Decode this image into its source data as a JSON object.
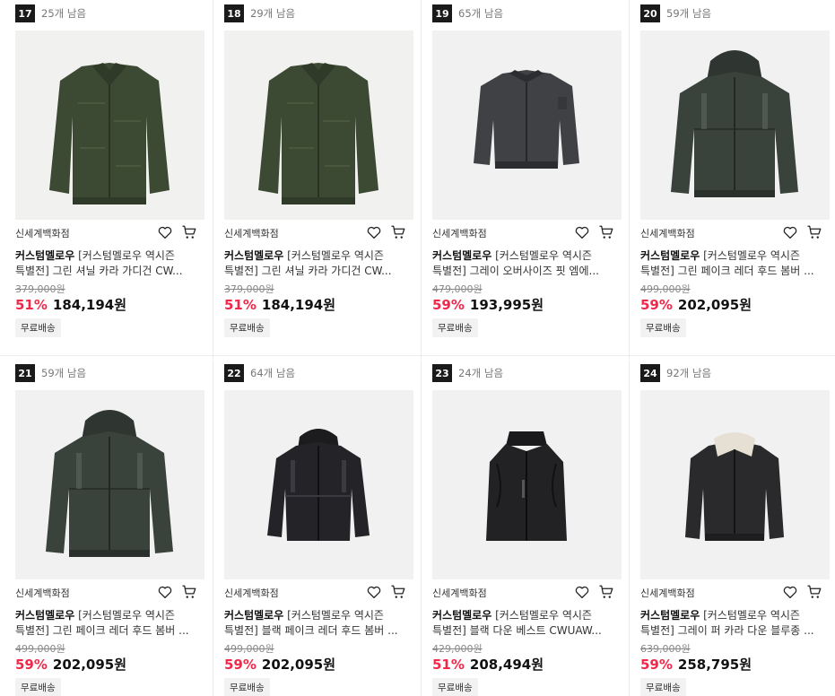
{
  "products": [
    {
      "rank": "17",
      "remaining": "25개 남음",
      "image": "green-knit-cardigan",
      "store": "신세계백화점",
      "brand": "커스텀멜로우",
      "title_l1": "[커스텀멜로우 역시즌",
      "title_l2": "특별전] 그린 셔닐 카라 가디건 CW...",
      "original_price": "379,000원",
      "discount": "51%",
      "price": "184,194원",
      "shipping": "무료배송"
    },
    {
      "rank": "18",
      "remaining": "29개 남음",
      "image": "green-knit-cardigan",
      "store": "신세계백화점",
      "brand": "커스텀멜로우",
      "title_l1": "[커스텀멜로우 역시즌",
      "title_l2": "특별전] 그린 셔닐 카라 가디건 CW...",
      "original_price": "379,000원",
      "discount": "51%",
      "price": "184,194원",
      "shipping": "무료배송"
    },
    {
      "rank": "19",
      "remaining": "65개 남음",
      "image": "grey-bomber-jacket",
      "store": "신세계백화점",
      "brand": "커스텀멜로우",
      "title_l1": "[커스텀멜로우 역시즌",
      "title_l2": "특별전] 그레이 오버사이즈 핏 엠에...",
      "original_price": "479,000원",
      "discount": "59%",
      "price": "193,995원",
      "shipping": "무료배송"
    },
    {
      "rank": "20",
      "remaining": "59개 남음",
      "image": "green-leather-hood-bomber",
      "store": "신세계백화점",
      "brand": "커스텀멜로우",
      "title_l1": "[커스텀멜로우 역시즌",
      "title_l2": "특별전] 그린 페이크 레더 후드 봄버 ...",
      "original_price": "499,000원",
      "discount": "59%",
      "price": "202,095원",
      "shipping": "무료배송"
    },
    {
      "rank": "21",
      "remaining": "59개 남음",
      "image": "green-leather-hood-bomber",
      "store": "신세계백화점",
      "brand": "커스텀멜로우",
      "title_l1": "[커스텀멜로우 역시즌",
      "title_l2": "특별전] 그린 페이크 레더 후드 봄버 ...",
      "original_price": "499,000원",
      "discount": "59%",
      "price": "202,095원",
      "shipping": "무료배송"
    },
    {
      "rank": "22",
      "remaining": "64개 남음",
      "image": "black-leather-hood-bomber",
      "store": "신세계백화점",
      "brand": "커스텀멜로우",
      "title_l1": "[커스텀멜로우 역시즌",
      "title_l2": "특별전] 블랙 페이크 레더 후드 봄버 ...",
      "original_price": "499,000원",
      "discount": "59%",
      "price": "202,095원",
      "shipping": "무료배송"
    },
    {
      "rank": "23",
      "remaining": "24개 남음",
      "image": "black-down-vest",
      "store": "신세계백화점",
      "brand": "커스텀멜로우",
      "title_l1": "[커스텀멜로우 역시즌",
      "title_l2": "특별전] 블랙 다운 베스트 CWUAW...",
      "original_price": "429,000원",
      "discount": "51%",
      "price": "208,494원",
      "shipping": "무료배송"
    },
    {
      "rank": "24",
      "remaining": "92개 남음",
      "image": "grey-fur-collar-blouson",
      "store": "신세계백화점",
      "brand": "커스텀멜로우",
      "title_l1": "[커스텀멜로우 역시즌",
      "title_l2": "특별전] 그레이 퍼 카라 다운 블루종 ...",
      "original_price": "639,000원",
      "discount": "59%",
      "price": "258,795원",
      "shipping": "무료배송"
    }
  ],
  "icons": {
    "wishlist": "heart-icon",
    "cart": "cart-icon"
  },
  "colors": {
    "discount": "#f0284a",
    "rank_badge": "#1a1a1a"
  }
}
